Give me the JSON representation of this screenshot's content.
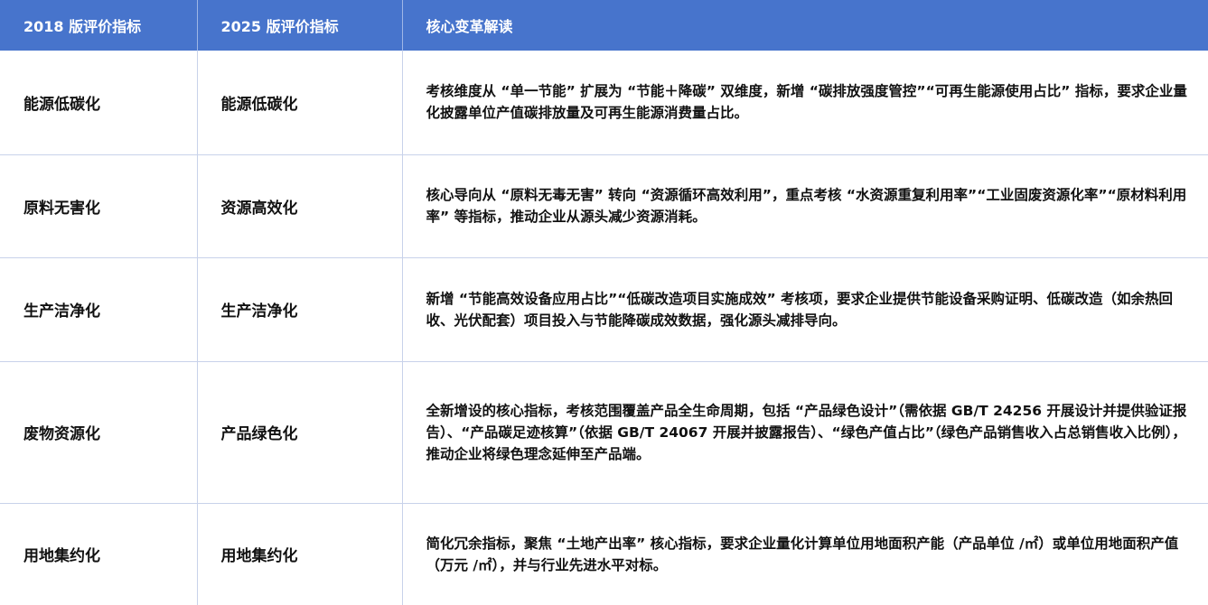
{
  "table": {
    "headers": [
      "2018 版评价指标",
      "2025 版评价指标",
      "核心变革解读"
    ],
    "rows": [
      {
        "old": "能源低碳化",
        "new": "能源低碳化",
        "desc": "考核维度从 “单一节能” 扩展为 “节能＋降碳” 双维度，新增 “碳排放强度管控”“可再生能源使用占比” 指标，要求企业量化披露单位产值碳排放量及可再生能源消费量占比。"
      },
      {
        "old": "原料无害化",
        "new": "资源高效化",
        "desc": "核心导向从 “原料无毒无害” 转向 “资源循环高效利用”，重点考核 “水资源重复利用率”“工业固废资源化率”“原材料利用率” 等指标，推动企业从源头减少资源消耗。"
      },
      {
        "old": "生产洁净化",
        "new": "生产洁净化",
        "desc": "新增 “节能高效设备应用占比”“低碳改造项目实施成效” 考核项，要求企业提供节能设备采购证明、低碳改造（如余热回收、光伏配套）项目投入与节能降碳成效数据，强化源头减排导向。"
      },
      {
        "old": "废物资源化",
        "new": "产品绿色化",
        "desc": "全新增设的核心指标，考核范围覆盖产品全生命周期，包括 “产品绿色设计”（需依据 GB/T 24256 开展设计并提供验证报告）、“产品碳足迹核算”（依据 GB/T 24067 开展并披露报告）、“绿色产值占比”（绿色产品销售收入占总销售收入比例），推动企业将绿色理念延伸至产品端。"
      },
      {
        "old": "用地集约化",
        "new": "用地集约化",
        "desc": "简化冗余指标，聚焦 “土地产出率” 核心指标，要求企业量化计算单位用地面积产能（产品单位 /㎡）或单位用地面积产值（万元 /㎡），并与行业先进水平对标。"
      }
    ]
  }
}
